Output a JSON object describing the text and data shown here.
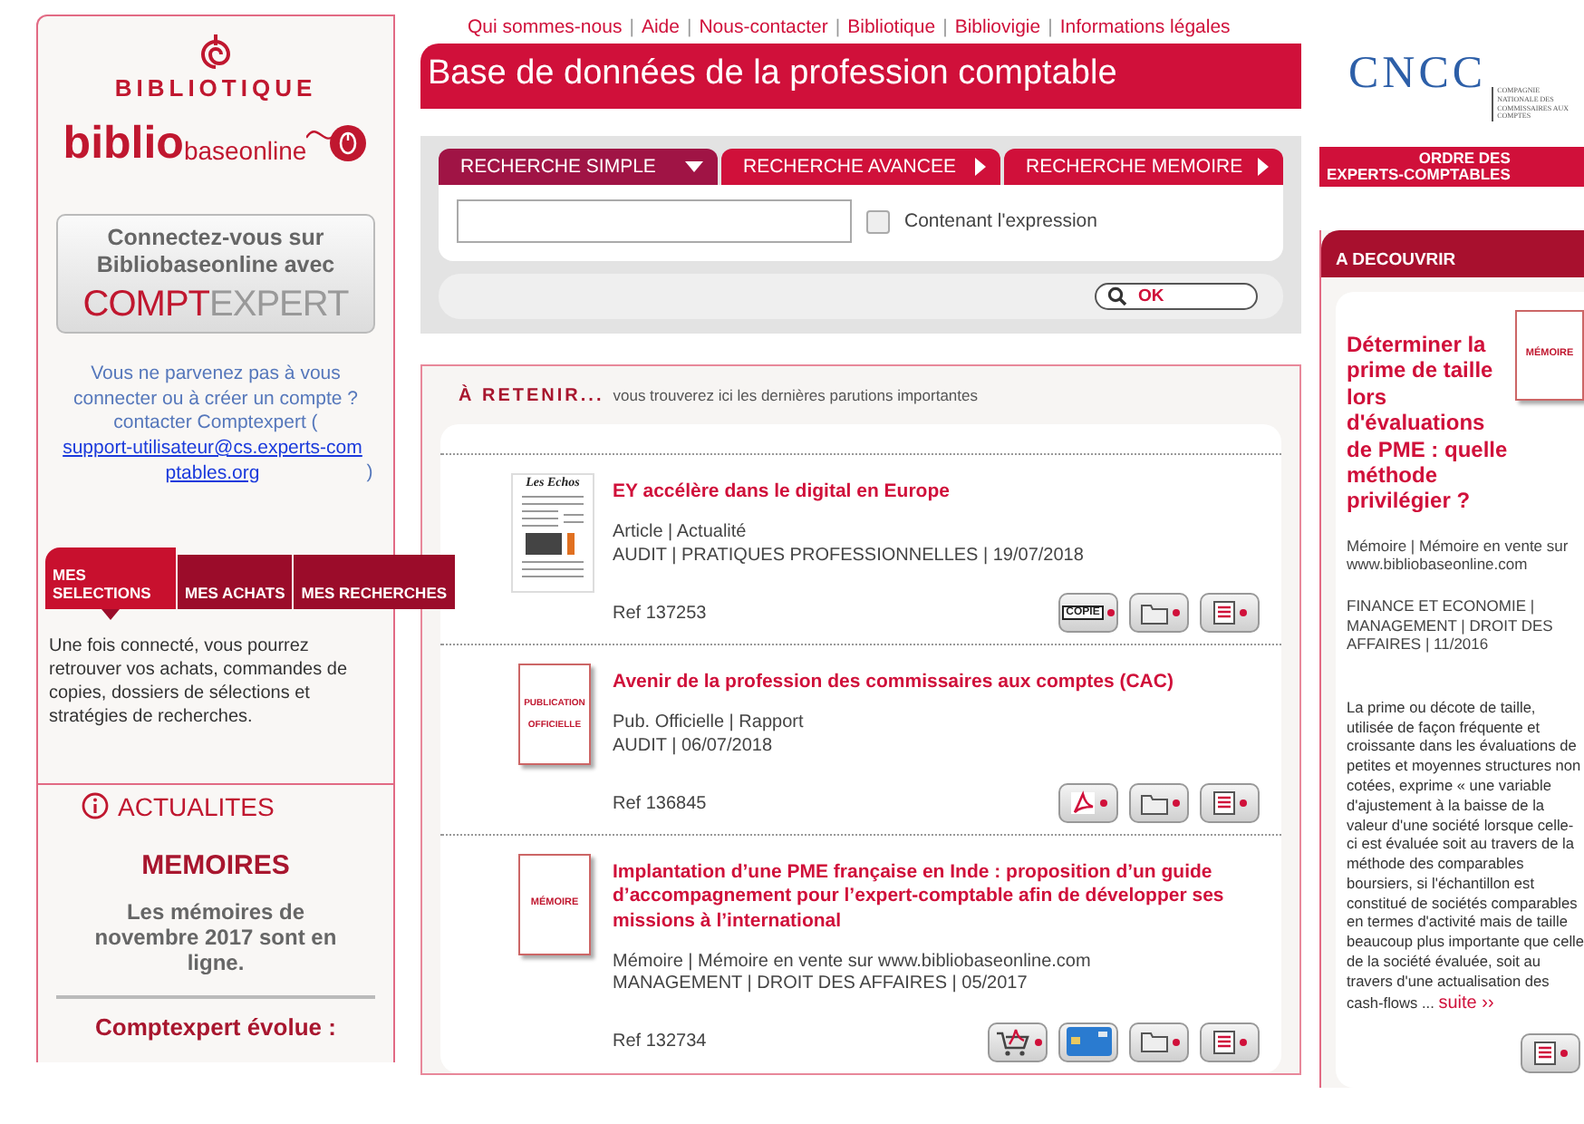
{
  "left": {
    "logo": {
      "top": "BIBLIOTIQUE",
      "main": "biblio",
      "sub": "baseonline"
    },
    "login_button": {
      "text": "Connectez-vous sur Bibliobaseonline avec",
      "brand_a": "COMPT",
      "brand_b": "EXPERT"
    },
    "help": {
      "text": "Vous ne parvenez pas à vous connecter ou à créer un compte ? contacter Comptexpert (",
      "link": "support-utilisateur@cs.experts-comptables.org",
      "after": ")"
    },
    "tabs": [
      {
        "label": "MES SELECTIONS",
        "selected": true
      },
      {
        "label": "MES ACHATS",
        "selected": false
      },
      {
        "label": "MES RECHERCHES",
        "selected": false
      }
    ],
    "tab_text": "Une fois connecté, vous pourrez retrouver vos achats, commandes de copies, dossiers de sélections et stratégies de recherches.",
    "news": {
      "heading": "ACTUALITES",
      "title": "MEMOIRES",
      "text": "Les mémoires de novembre 2017 sont en ligne.",
      "next": "Comptexpert évolue :"
    }
  },
  "nav": {
    "separator": "|",
    "links": [
      "Qui sommes-nous",
      "Aide",
      "Nous-contacter",
      "Bibliotique",
      "Bibliovigie",
      "Informations légales"
    ]
  },
  "banner": "Base de données de la profession comptable",
  "search": {
    "tabs": [
      {
        "label": "RECHERCHE SIMPLE",
        "selected": true
      },
      {
        "label": "RECHERCHE AVANCEE",
        "selected": false
      },
      {
        "label": "RECHERCHE MEMOIRE",
        "selected": false
      }
    ],
    "option": {
      "label": "Contenant l'expression",
      "checked": false
    },
    "button": "OK"
  },
  "results": {
    "heading": "À RETENIR...",
    "subheading": "vous trouverez ici les dernières parutions importantes",
    "items": [
      {
        "thumb": {
          "kind": "newspaper",
          "text": "Les Echos"
        },
        "title": "EY accélère dans le digital en Europe",
        "meta": "Article | Actualité",
        "topics": "AUDIT | PRATIQUES PROFESSIONNELLES | 19/07/2018",
        "ref": "Ref 137253",
        "actions": [
          {
            "kind": "copy",
            "label": "COPIE"
          },
          {
            "kind": "folder"
          },
          {
            "kind": "notice"
          }
        ]
      },
      {
        "thumb": {
          "kind": "cover",
          "text": "PUBLICATION OFFICIELLE"
        },
        "title": "Avenir de la profession des commissaires aux comptes (CAC)",
        "meta": "Pub. Officielle | Rapport",
        "topics": "AUDIT | 06/07/2018",
        "ref": "Ref 136845",
        "actions": [
          {
            "kind": "pdf"
          },
          {
            "kind": "folder"
          },
          {
            "kind": "notice"
          }
        ]
      },
      {
        "thumb": {
          "kind": "cover",
          "text": "MÉMOIRE"
        },
        "title": "Implantation d’une PME française en Inde : proposition d’un guide d’accompagnement pour l’expert-comptable afin de développer ses missions à l’international",
        "meta": "Mémoire | Mémoire en vente sur www.bibliobaseonline.com",
        "topics": "MANAGEMENT | DROIT DES AFFAIRES | 05/2017",
        "ref": "Ref 132734",
        "actions": [
          {
            "kind": "cart"
          },
          {
            "kind": "card"
          },
          {
            "kind": "folder"
          },
          {
            "kind": "notice"
          }
        ]
      }
    ]
  },
  "right": {
    "cncc": {
      "name": "CNCC",
      "full": "COMPAGNIE NATIONALE DES COMMISSAIRES AUX COMPTES"
    },
    "ordre": {
      "line1": "ORDRE DES",
      "line2": "EXPERTS-COMPTABLES"
    },
    "discover": {
      "heading": "A DECOUVRIR",
      "title": "Déterminer la prime de taille lors d'évaluations de PME : quelle méthode privilégier ?",
      "cover": "MÉMOIRE",
      "meta": "Mémoire | Mémoire en vente sur www.bibliobaseonline.com",
      "topics": "FINANCE ET ECONOMIE | MANAGEMENT | DROIT DES AFFAIRES | 11/2016",
      "text": "La prime ou décote de taille, utilisée de façon fréquente et croissante dans les évaluations de petites et moyennes structures non cotées, exprime « une variable d'ajustement à la baisse de la valeur d'une société lorsque celle-ci est évaluée soit au travers de la méthode des comparables boursiers, si l'échantillon est constitué de sociétés comparables en termes d'activité mais de taille beaucoup plus importante que celle de la société évaluée, soit au travers d'une actualisation des cash-flows ...",
      "more": "suite ››"
    }
  }
}
